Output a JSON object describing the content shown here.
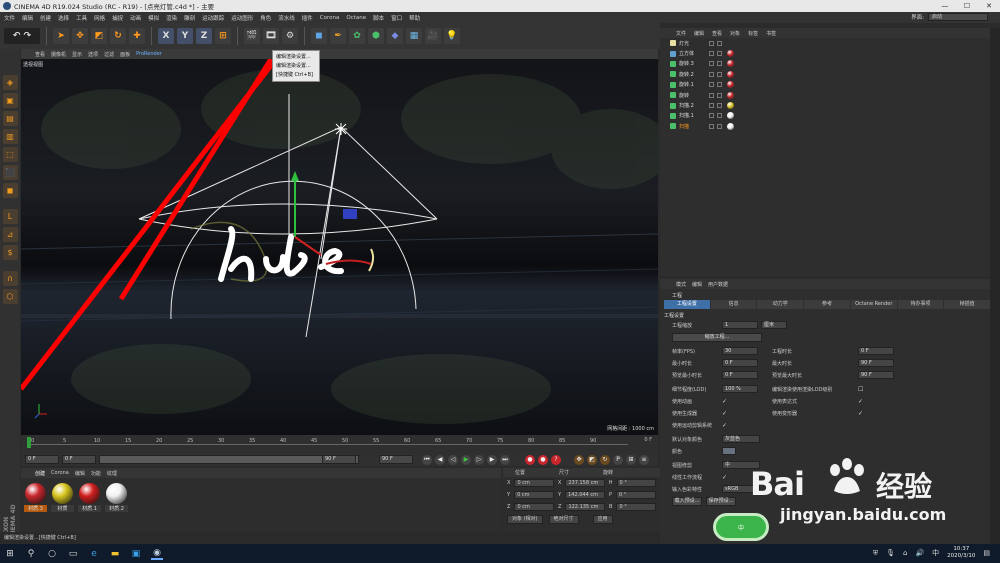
{
  "window": {
    "title": "CINEMA 4D R19.024 Studio (RC - R19) - [点亮灯管.c4d *] - 主要"
  },
  "menubar": [
    "文件",
    "编辑",
    "创建",
    "选择",
    "工具",
    "网格",
    "捕捉",
    "动画",
    "模拟",
    "渲染",
    "雕刻",
    "运动跟踪",
    "运动图形",
    "角色",
    "流水线",
    "插件",
    "Corona",
    "Octane",
    "脚本",
    "窗口",
    "帮助"
  ],
  "interface": {
    "label": "界面:",
    "value": "启动"
  },
  "toolbar": {
    "axes": [
      "X",
      "Y",
      "Z"
    ]
  },
  "viewport": {
    "menu": [
      "查看",
      "摄像机",
      "显示",
      "选项",
      "过滤",
      "面板"
    ],
    "renderer": "ProRender",
    "label": "透视视图",
    "grid_info": "网格间距 : 1000 cm",
    "hotkey_popup": [
      "编辑渲染设置...",
      "编辑渲染设置...",
      "[快捷键 Ctrl+B]"
    ]
  },
  "timeline": {
    "ticks": [
      "0",
      "5",
      "10",
      "15",
      "20",
      "25",
      "30",
      "35",
      "40",
      "45",
      "50",
      "55",
      "60",
      "65",
      "70",
      "75",
      "80",
      "85",
      "90"
    ],
    "end_label": "0 F",
    "fields": [
      "0 F",
      "0 F",
      "90 F",
      "90 F"
    ]
  },
  "materials": {
    "tabs": [
      "创建",
      "Corona",
      "编辑",
      "功能",
      "纹理"
    ],
    "items": [
      {
        "name": "材质.3",
        "color": "#c8262c"
      },
      {
        "name": "材质",
        "color": "#d6c51f"
      },
      {
        "name": "材质.1",
        "color": "#d01e1e"
      },
      {
        "name": "材质.2",
        "color": "#f2f2f2"
      }
    ]
  },
  "coordinates": {
    "headers": [
      "位置",
      "尺寸",
      "旋转"
    ],
    "rows": [
      {
        "axis": "X",
        "pos": "0 cm",
        "size": "237.158 cm",
        "rlabel": "H",
        "rot": "0 °"
      },
      {
        "axis": "Y",
        "pos": "0 cm",
        "size": "142.044 cm",
        "rlabel": "P",
        "rot": "0 °"
      },
      {
        "axis": "Z",
        "pos": "0 cm",
        "size": "122.135 cm",
        "rlabel": "B",
        "rot": "0 °"
      }
    ],
    "mode": "对象 (相对)",
    "size_mode": "绝对尺寸",
    "apply": "应用"
  },
  "object_manager": {
    "menu": [
      "文件",
      "编辑",
      "查看",
      "对象",
      "标签",
      "书签"
    ],
    "objects": [
      {
        "name": "灯光",
        "dot": ""
      },
      {
        "name": "立方体",
        "dot": "#c8262c"
      },
      {
        "name": "旋转.3",
        "dot": "#c8262c"
      },
      {
        "name": "旋转.2",
        "dot": "#c8262c"
      },
      {
        "name": "旋转.1",
        "dot": "#c8262c"
      },
      {
        "name": "旋转",
        "dot": "#c8262c"
      },
      {
        "name": "扫描.2",
        "dot": "#d6c51f"
      },
      {
        "name": "扫描.1",
        "dot": "#f2f2f2"
      },
      {
        "name": "扫描",
        "dot": "#f2f2f2"
      }
    ]
  },
  "attributes": {
    "menu": [
      "模式",
      "编辑",
      "用户数据"
    ],
    "title": "工程",
    "tabs": [
      "工程设置",
      "信息",
      "动力学",
      "参考",
      "Octane Render",
      "待办事项",
      "帧插值"
    ],
    "section": "工程设置",
    "scale_label": "工程缩放",
    "scale_value": "1",
    "scale_unit": "厘米",
    "scale_button": "缩放工程...",
    "fps_label": "帧率(FPS)",
    "fps": "30",
    "time_label": "工程时长",
    "time": "0 F",
    "min_label": "最小时长",
    "min": "0 F",
    "max_label": "最大时长",
    "max": "90 F",
    "pmin_label": "预览最小时长",
    "pmin": "0 F",
    "pmax_label": "预览最大时长",
    "pmax": "90 F",
    "lod_label": "细节程度(LOD)",
    "lod": "100 %",
    "lod_render_label": "编辑渲染使用渲染LOD级别",
    "anim_label": "使用动画",
    "expr_label": "使用表达式",
    "gen_label": "使用生成器",
    "deform_label": "使用变形器",
    "motion_label": "使用运动剪辑系统",
    "objcolor_label": "默认对象颜色",
    "objcolor": "灰蓝色",
    "color_label": "颜色",
    "clip_label": "视图修剪",
    "clip": "中",
    "linear_label": "线性工作流程",
    "profile_label": "输入色彩特性",
    "profile": "sRGB",
    "load_button": "载入预设...",
    "save_button": "保存预设..."
  },
  "statusbar": "编辑渲染设置...[快捷键 Ctrl+B]",
  "taskbar": {
    "time": "10:37",
    "date": "2020/3/10",
    "lang": "中"
  },
  "watermark": {
    "brand": "Bai",
    "brand2": "经验",
    "url": "jingyan.baidu.com"
  }
}
